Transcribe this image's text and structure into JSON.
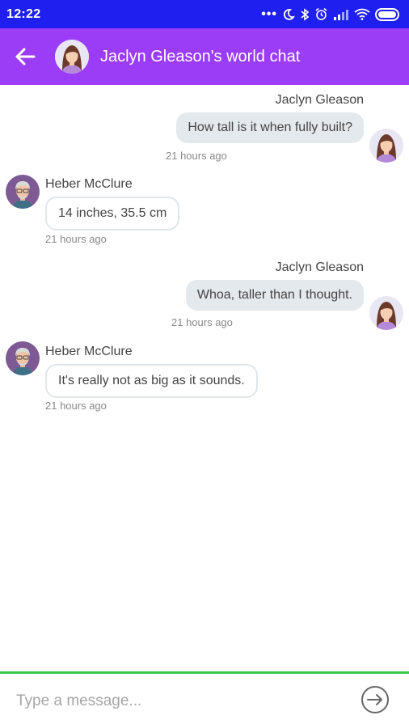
{
  "status_bar": {
    "time": "12:22",
    "dots": "•••",
    "icons": [
      "moon-icon",
      "bluetooth-icon",
      "alarm-icon",
      "signal-icon",
      "wifi-icon",
      "battery-icon"
    ]
  },
  "header": {
    "title": "Jaclyn Gleason's world chat",
    "back_icon": "back-arrow-icon"
  },
  "messages": [
    {
      "direction": "outgoing",
      "sender": "Jaclyn Gleason",
      "text": "How tall is it when fully built?",
      "time": "21 hours ago"
    },
    {
      "direction": "incoming",
      "sender": "Heber  McClure",
      "text": "14 inches, 35.5 cm",
      "time": "21 hours ago"
    },
    {
      "direction": "outgoing",
      "sender": "Jaclyn Gleason",
      "text": "Whoa, taller than I thought.",
      "time": "21 hours ago"
    },
    {
      "direction": "incoming",
      "sender": "Heber  McClure",
      "text": "It's really not as big as it sounds.",
      "time": "21 hours ago"
    }
  ],
  "composer": {
    "placeholder": "Type a message...",
    "value": "",
    "send_icon": "send-icon"
  },
  "colors": {
    "status_bar": "#1f1ff0",
    "app_bar": "#9b3cf7",
    "outgoing_bubble": "#e4e9ee",
    "incoming_border": "#e0e6ea",
    "input_divider": "#3cc84a"
  }
}
